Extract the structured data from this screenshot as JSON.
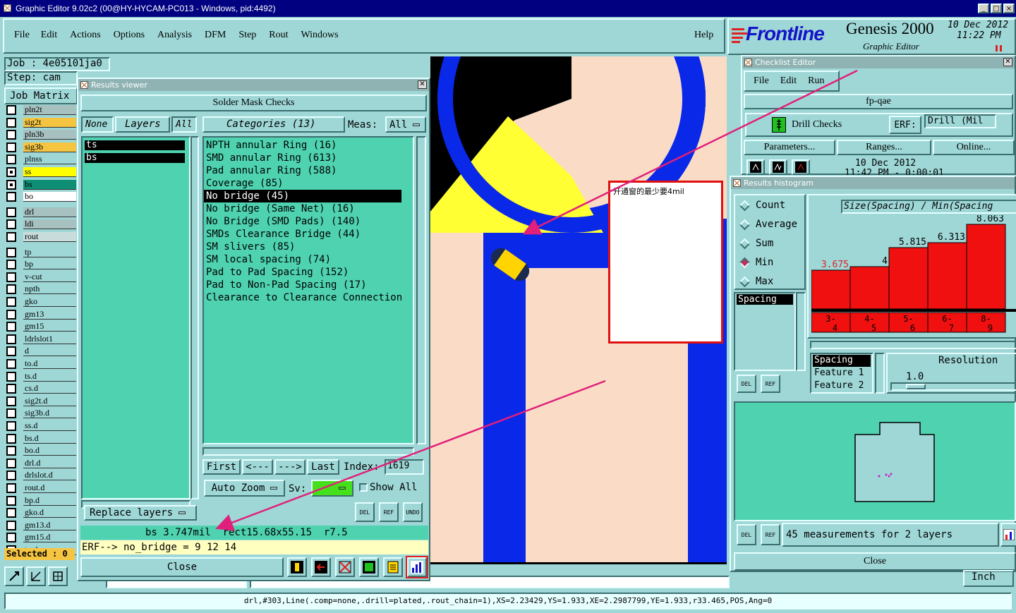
{
  "window": {
    "title": "Graphic Editor 9.02c2 (00@HY-HYCAM-PC013 - Windows, pid:4492)",
    "controls": [
      "_",
      "□",
      "×"
    ]
  },
  "menu": {
    "items": [
      "File",
      "Edit",
      "Actions",
      "Options",
      "Analysis",
      "DFM",
      "Step",
      "Rout",
      "Windows"
    ],
    "help": "Help"
  },
  "brand": {
    "logo": "Frontline",
    "product": "Genesis 2000",
    "sub": "Graphic Editor",
    "date": "10 Dec 2012",
    "time": "11:22 PM",
    "logo_color": "#1414c8",
    "stripe_color": "#e02020"
  },
  "job": {
    "job_label": "Job : 4e05101ja0",
    "step_label": "Step: cam",
    "matrix_button": "Job Matrix"
  },
  "layers": [
    {
      "name": "pln2t",
      "on": false,
      "color": "#a7c0c0"
    },
    {
      "name": "sig2t",
      "on": false,
      "color": "#f5c542"
    },
    {
      "name": "pln3b",
      "on": false,
      "color": "#a7c0c0"
    },
    {
      "name": "sig3b",
      "on": false,
      "color": "#f5c542"
    },
    {
      "name": "plnss",
      "on": false,
      "color": "#9fd7d7"
    },
    {
      "name": "ss",
      "on": true,
      "color": "#ffff00"
    },
    {
      "name": "bs",
      "on": true,
      "color": "#0e8f75"
    },
    {
      "name": "bo",
      "on": false,
      "color": "#ffffff"
    },
    {
      "name": "drl",
      "on": false,
      "color": "#a7c0c0"
    },
    {
      "name": "ldi",
      "on": false,
      "color": "#a7c0c0"
    },
    {
      "name": "rout",
      "on": false,
      "color": "#c8dcdc"
    },
    {
      "name": "tp",
      "on": false,
      "color": "#9fd7d7"
    },
    {
      "name": "bp",
      "on": false,
      "color": "#9fd7d7"
    },
    {
      "name": "v-cut",
      "on": false,
      "color": "#9fd7d7"
    },
    {
      "name": "npth",
      "on": false,
      "color": "#9fd7d7"
    },
    {
      "name": "gko",
      "on": false,
      "color": "#9fd7d7"
    },
    {
      "name": "gm13",
      "on": false,
      "color": "#9fd7d7"
    },
    {
      "name": "gm15",
      "on": false,
      "color": "#9fd7d7"
    },
    {
      "name": "ldrlslot1",
      "on": false,
      "color": "#9fd7d7"
    },
    {
      "name": "d",
      "on": false,
      "color": "#9fd7d7"
    },
    {
      "name": "to.d",
      "on": false,
      "color": "#9fd7d7"
    },
    {
      "name": "ts.d",
      "on": false,
      "color": "#9fd7d7"
    },
    {
      "name": "cs.d",
      "on": false,
      "color": "#9fd7d7"
    },
    {
      "name": "sig2t.d",
      "on": false,
      "color": "#9fd7d7"
    },
    {
      "name": "sig3b.d",
      "on": false,
      "color": "#9fd7d7"
    },
    {
      "name": "ss.d",
      "on": false,
      "color": "#9fd7d7"
    },
    {
      "name": "bs.d",
      "on": false,
      "color": "#9fd7d7"
    },
    {
      "name": "bo.d",
      "on": false,
      "color": "#9fd7d7"
    },
    {
      "name": "drl.d",
      "on": false,
      "color": "#9fd7d7"
    },
    {
      "name": "drlslot.d",
      "on": false,
      "color": "#9fd7d7"
    },
    {
      "name": "rout.d",
      "on": false,
      "color": "#9fd7d7"
    },
    {
      "name": "bp.d",
      "on": false,
      "color": "#9fd7d7"
    },
    {
      "name": "gko.d",
      "on": false,
      "color": "#9fd7d7"
    },
    {
      "name": "gm13.d",
      "on": false,
      "color": "#9fd7d7"
    },
    {
      "name": "gm15.d",
      "on": false,
      "color": "#9fd7d7"
    },
    {
      "name": "tp.d",
      "on": false,
      "color": "#9fd7d7"
    }
  ],
  "selected_label": "Selected : 0",
  "results_viewer": {
    "title": "Results viewer",
    "header": "Solder Mask Checks",
    "filter": {
      "none": "None",
      "layers": "Layers",
      "all": "All"
    },
    "layer_list": [
      "ts",
      "bs"
    ],
    "categories_label": "Categories (13)",
    "meas_label": "Meas:",
    "meas_value": "All",
    "categories": [
      "NPTH annular Ring (16)",
      "SMD annular Ring (613)",
      "Pad annular Ring (588)",
      "Coverage (85)",
      "No bridge (45)",
      "No bridge (Same Net) (16)",
      "No Bridge (SMD Pads) (140)",
      "SMDs Clearance Bridge (44)",
      "SM slivers (85)",
      "SM local spacing (74)",
      "Pad to Pad Spacing (152)",
      "Pad to Non-Pad Spacing (17)",
      "Clearance to Clearance Connection"
    ],
    "selected_category": "No bridge (45)",
    "nav": {
      "first": "First",
      "prev": "<---",
      "next": "--->",
      "last": "Last",
      "index_label": "Index:",
      "index_value": "1619"
    },
    "auto_zoom": "Auto Zoom",
    "sv_label": "Sv:",
    "show_all": "Show All",
    "replace_layers": "Replace layers",
    "icons": [
      "DEL",
      "REF",
      "UNDO"
    ],
    "status_line": "bs 3.747mil  rect15.68x55.15  r7.5",
    "erf_line": "ERF--> no_bridge = 9 12 14",
    "close": "Close"
  },
  "annotation": {
    "text": "开通窗的最少要4mil",
    "arrow_color": "#e0207a",
    "border_color": "#e01010"
  },
  "checklist": {
    "title": "Checklist Editor",
    "menu": [
      "File",
      "Edit",
      "Run"
    ],
    "name": "fp-qae",
    "check_name": "Drill Checks",
    "erf_label": "ERF:",
    "erf_value": "Drill (Mil",
    "buttons": [
      "Parameters...",
      "Ranges...",
      "Online..."
    ],
    "date": "10 Dec 2012",
    "time": "11:42 PM - 0:00:01"
  },
  "histogram": {
    "title": "Results histogram",
    "modes": [
      "Count",
      "Average",
      "Sum",
      "Min",
      "Max"
    ],
    "selected_mode": "Min",
    "attr_list": [
      "Spacing"
    ],
    "chart_title": "Size(Spacing) / Min(Spacing",
    "bars": [
      {
        "label": "3-4",
        "value": "3.675"
      },
      {
        "label": "4-5",
        "value": "4"
      },
      {
        "label": "5-6",
        "value": "5.815"
      },
      {
        "label": "6-7",
        "value": "6.313"
      },
      {
        "label": "8-9",
        "value": "8.063"
      }
    ],
    "field_list": [
      "Spacing",
      "Feature 1",
      "Feature 2"
    ],
    "resolution_label": "Resolution",
    "resolution_value": "1.0",
    "measurements": "45 measurements for 2 layers",
    "close": "Close",
    "first_value_color": "#e02020"
  },
  "units": "Inch",
  "status_bar": "drl,#303,Line(.comp=none,.drill=plated,.rout_chain=1),XS=2.23429,YS=1.933,XE=2.2987799,YE=1.933,r33.465,POS,Ang=0"
}
